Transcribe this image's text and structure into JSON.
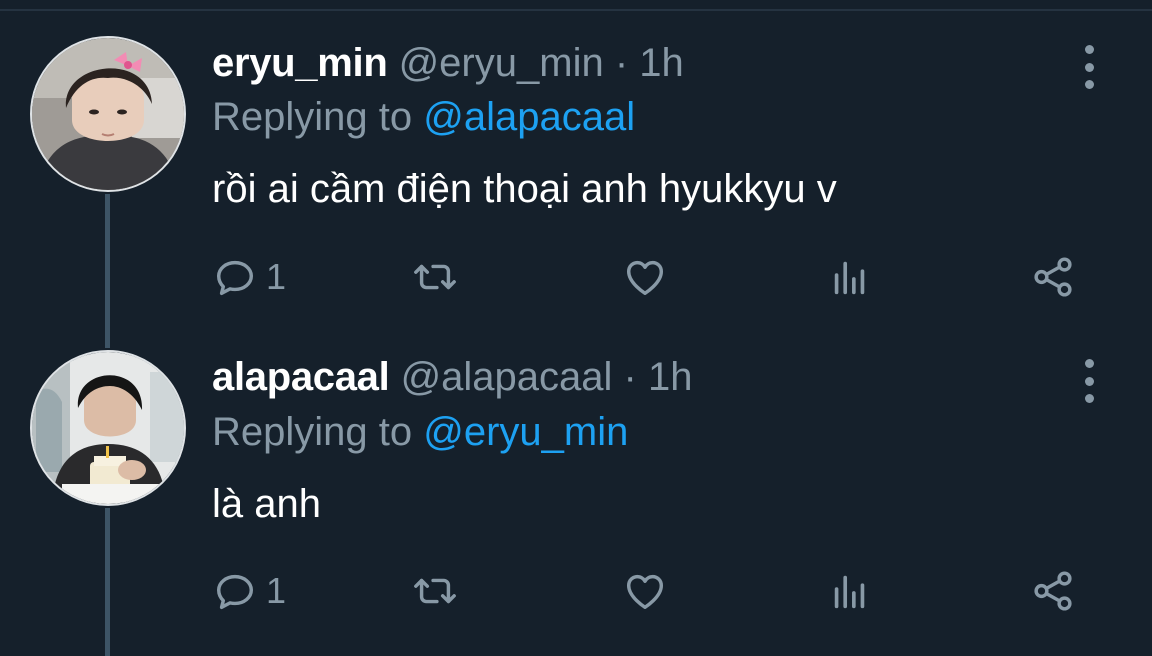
{
  "colors": {
    "background": "#15202b",
    "text": "#ffffff",
    "secondary": "#8899a6",
    "accent": "#1da1f2",
    "thread_line": "#3d5466"
  },
  "tweets": [
    {
      "display_name": "eryu_min",
      "handle": "@eryu_min",
      "separator": "·",
      "time": "1h",
      "replying_prefix": "Replying to",
      "replying_to": "@alapacaal",
      "text": "rồi ai cầm điện thoại anh hyukkyu v",
      "reply_count": "1",
      "icons": [
        "reply-icon",
        "retweet-icon",
        "like-icon",
        "analytics-icon",
        "share-icon",
        "more-icon"
      ]
    },
    {
      "display_name": "alapacaal",
      "handle": "@alapacaal",
      "separator": "·",
      "time": "1h",
      "replying_prefix": "Replying to",
      "replying_to": "@eryu_min",
      "text": "là anh",
      "reply_count": "1",
      "icons": [
        "reply-icon",
        "retweet-icon",
        "like-icon",
        "analytics-icon",
        "share-icon",
        "more-icon"
      ]
    }
  ]
}
